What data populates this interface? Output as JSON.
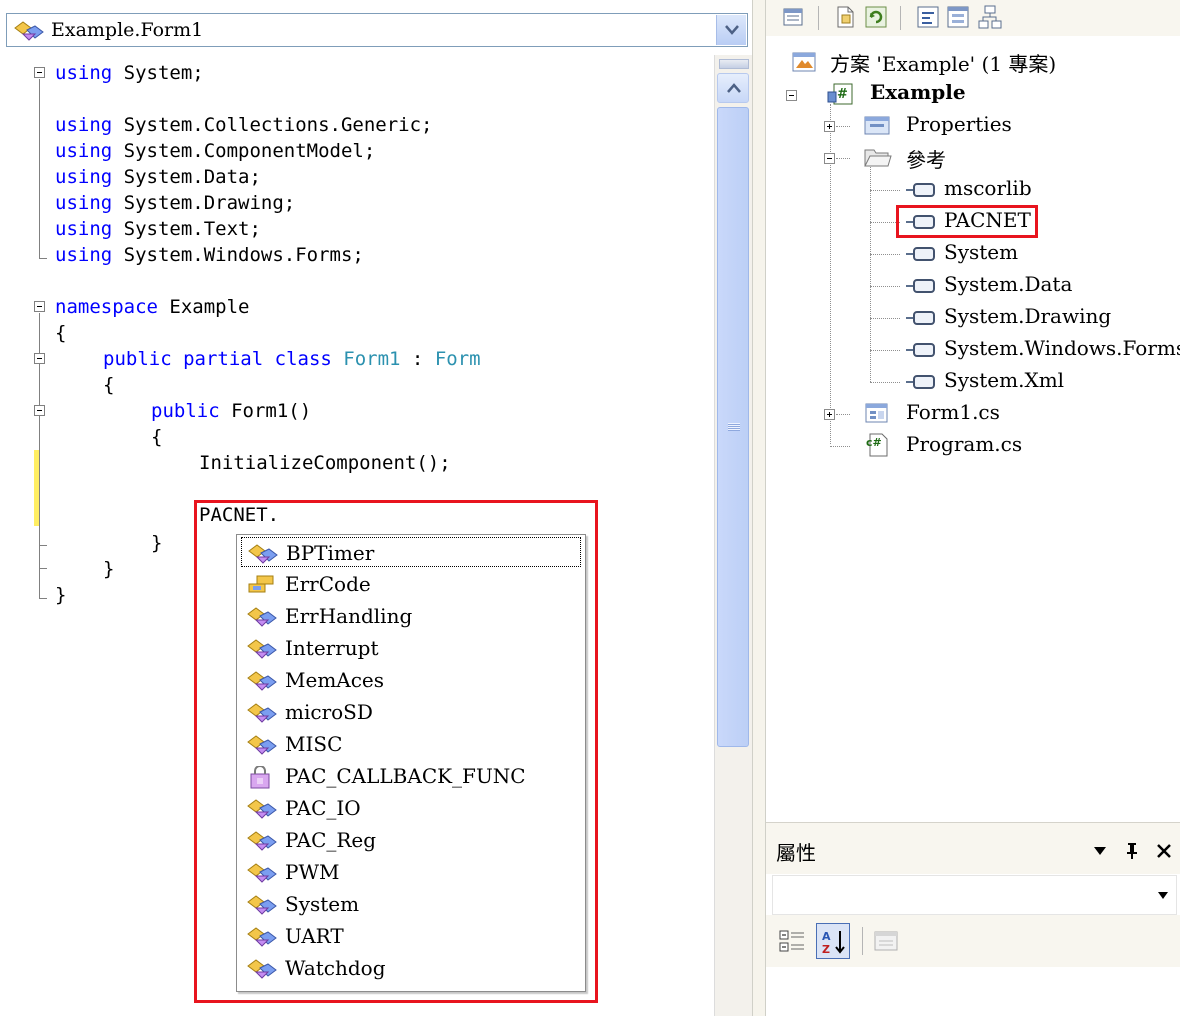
{
  "editor": {
    "class_combo": "Example.Form1",
    "code_lines": [
      {
        "kw": "using",
        "rest": " System;"
      },
      {
        "kw": "using",
        "rest": " System.Collections.Generic;"
      },
      {
        "kw": "using",
        "rest": " System.ComponentModel;"
      },
      {
        "kw": "using",
        "rest": " System.Data;"
      },
      {
        "kw": "using",
        "rest": " System.Drawing;"
      },
      {
        "kw": "using",
        "rest": " System.Text;"
      },
      {
        "kw": "using",
        "rest": " System.Windows.Forms;"
      }
    ],
    "namespace_kw": "namespace",
    "namespace_name": " Example",
    "brace_open": "{",
    "brace_close": "}",
    "class_public": "public",
    "class_partial": "partial",
    "class_kw": "class",
    "class_name": "Form1",
    "class_colon": " : ",
    "class_base": "Form",
    "ctor_public": "public",
    "ctor_name": " Form1()",
    "init_call": "InitializeComponent();",
    "typed_text": "PACNET."
  },
  "intellisense": {
    "items": [
      {
        "label": "BPTimer",
        "icon": "class-icon",
        "selected": true
      },
      {
        "label": "ErrCode",
        "icon": "enum-icon"
      },
      {
        "label": "ErrHandling",
        "icon": "class-icon"
      },
      {
        "label": "Interrupt",
        "icon": "class-icon"
      },
      {
        "label": "MemAces",
        "icon": "class-icon"
      },
      {
        "label": "microSD",
        "icon": "class-icon"
      },
      {
        "label": "MISC",
        "icon": "class-icon"
      },
      {
        "label": "PAC_CALLBACK_FUNC",
        "icon": "delegate-icon"
      },
      {
        "label": "PAC_IO",
        "icon": "class-icon"
      },
      {
        "label": "PAC_Reg",
        "icon": "class-icon"
      },
      {
        "label": "PWM",
        "icon": "class-icon"
      },
      {
        "label": "System",
        "icon": "class-icon"
      },
      {
        "label": "UART",
        "icon": "class-icon"
      },
      {
        "label": "Watchdog",
        "icon": "class-icon"
      }
    ]
  },
  "solution": {
    "solution_label": "方案 'Example' (1 專案)",
    "project_label": "Example",
    "properties_label": "Properties",
    "references_label": "參考",
    "references": [
      "mscorlib",
      "PACNET",
      "System",
      "System.Data",
      "System.Drawing",
      "System.Windows.Forms",
      "System.Xml"
    ],
    "form_label": "Form1.cs",
    "program_label": "Program.cs"
  },
  "properties": {
    "title": "屬性",
    "pin_btn": "▾ ㄗ ✕"
  },
  "colors": {
    "highlight_red": "#e8141e",
    "keyword_blue": "#0000ff",
    "type_teal": "#2b91af"
  }
}
